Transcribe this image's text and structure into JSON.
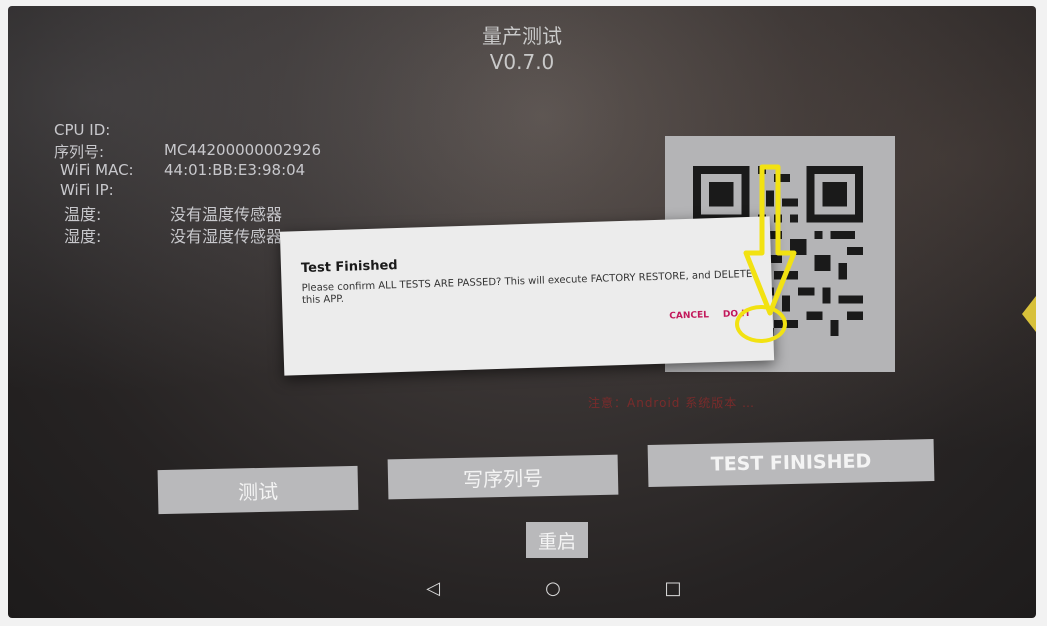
{
  "header": {
    "title": "量产测试",
    "version": "V0.7.0"
  },
  "info": {
    "cpu_id_label": "CPU ID:",
    "cpu_id_value": "",
    "serial_label": "序列号:",
    "serial_value": "MC44200000002926",
    "wifi_mac_label": "WiFi MAC:",
    "wifi_mac_value": "44:01:BB:E3:98:04",
    "wifi_ip_label": "WiFi IP:",
    "wifi_ip_value": "",
    "temperature_label": "温度:",
    "temperature_value": "没有温度传感器",
    "humidity_label": "湿度:",
    "humidity_value": "没有湿度传感器"
  },
  "warning_text": "注意：Android 系统版本 …",
  "dialog": {
    "title": "Test Finished",
    "message": "Please confirm ALL TESTS ARE PASSED? This will execute FACTORY RESTORE, and DELETE this APP.",
    "cancel_label": "CANCEL",
    "confirm_label": "DO IT"
  },
  "buttons": {
    "test": "测试",
    "write_serial": "写序列号",
    "test_finished": "TEST FINISHED",
    "reboot": "重启"
  },
  "navbar": {
    "back": "◁",
    "home": "○",
    "recent": "□"
  },
  "colors": {
    "dialog_accent": "#c2185b",
    "highlight": "#f2e212",
    "button_bg": "#b9b9bb"
  },
  "icons": [
    "qr-code-icon",
    "arrow-down-annotation-icon",
    "back-icon",
    "home-icon",
    "recent-apps-icon"
  ]
}
